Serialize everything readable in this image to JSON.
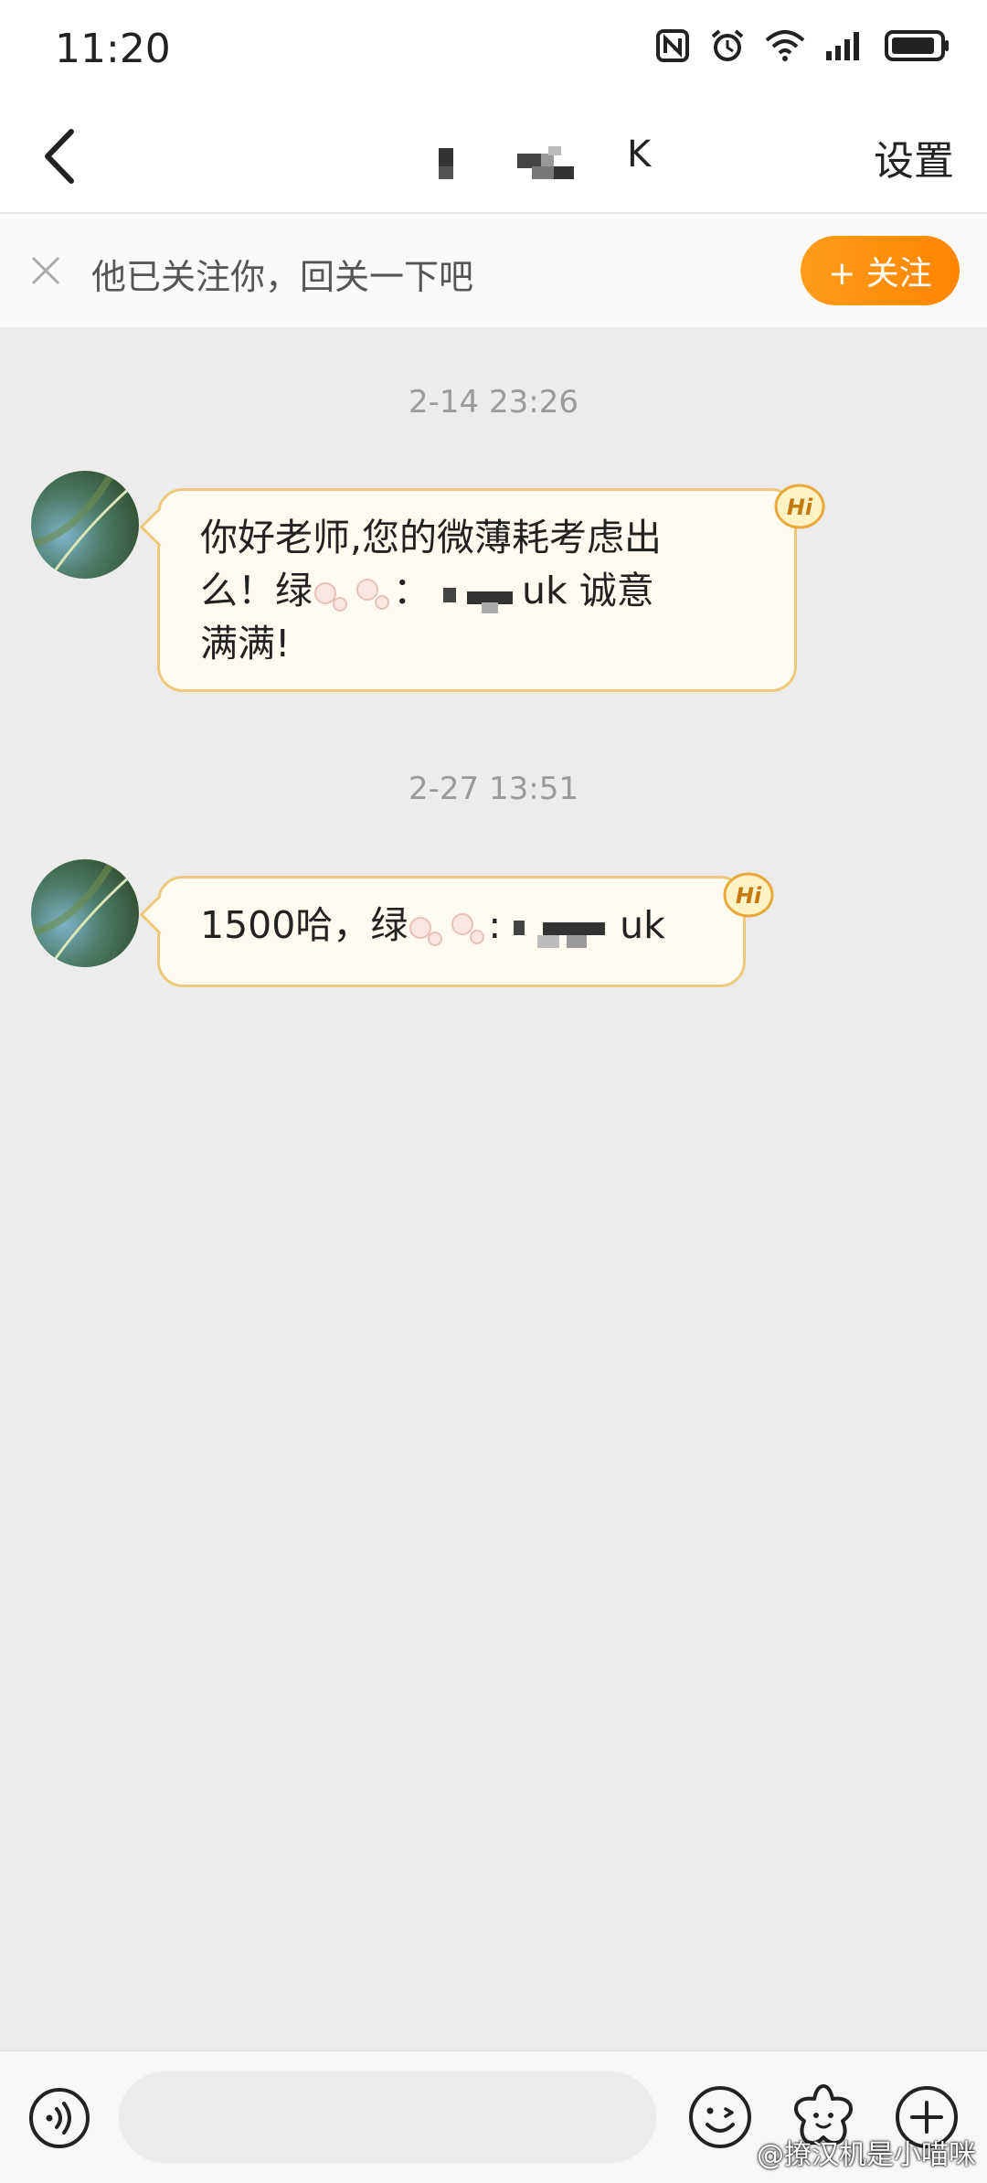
{
  "status_bar": {
    "time": "11:20"
  },
  "header": {
    "title": "K",
    "settings_label": "设置"
  },
  "follow_banner": {
    "text": "他已关注你，回关一下吧",
    "follow_label": "+ 关注"
  },
  "messages": [
    {
      "timestamp": "2-14 23:26",
      "line1": "你好老师,您的微薄耗考虑出",
      "line2_a": "么！绿",
      "line2_b": "：",
      "line2_c": "uk  诚意",
      "line3": "满满!",
      "badge": "Hi"
    },
    {
      "timestamp": "2-27 13:51",
      "line1_a": "1500哈，绿",
      "line1_b": ":",
      "line1_c": "uk",
      "badge": "Hi"
    }
  ],
  "input": {
    "placeholder": ""
  },
  "watermark": "@撩汉机是小喵咪",
  "colors": {
    "accent": "#ff8c00",
    "bubble_border": "#eec97c",
    "bubble_bg": "#fffbf0",
    "background": "#ececec"
  }
}
